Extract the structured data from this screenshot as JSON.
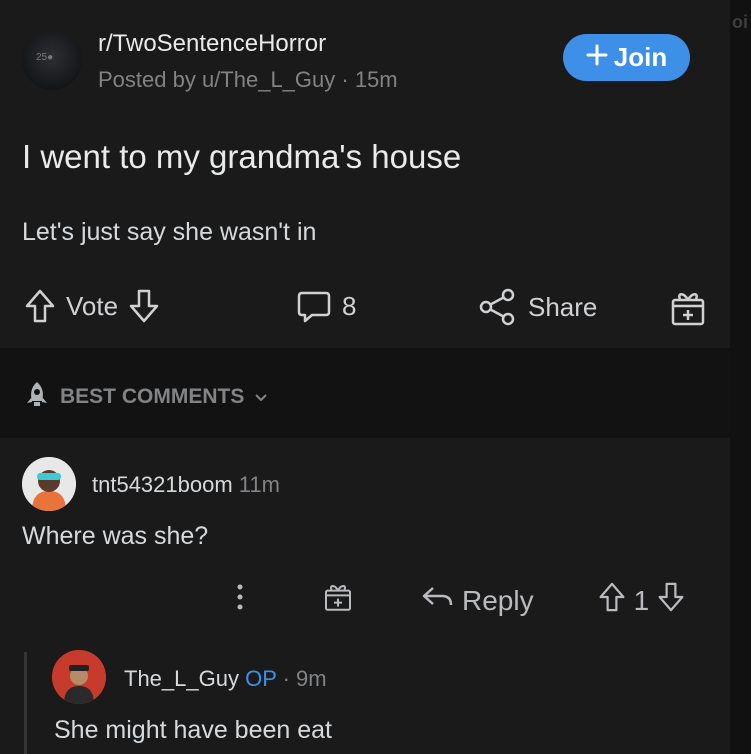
{
  "post": {
    "subreddit": "r/TwoSentenceHorror",
    "avatar_text": "25●",
    "posted_by": "Posted by u/The_L_Guy · 15m",
    "join_label": "Join",
    "title": "I went to my grandma's house",
    "body": "Let's just say she wasn't in",
    "vote_label": "Vote",
    "comment_count": "8",
    "share_label": "Share"
  },
  "sort": {
    "label": "BEST COMMENTS"
  },
  "edge_hint": "oi",
  "comments": [
    {
      "user": "tnt54321boom",
      "time": "11m",
      "text": "Where was she?",
      "reply_label": "Reply",
      "votes": "1"
    },
    {
      "user": "The_L_Guy",
      "op_badge": "OP",
      "time": "· 9m",
      "text": "She might have been eat"
    }
  ],
  "colors": {
    "accent": "#3d8fe7",
    "bg": "#1a1a1b",
    "text": "#d7dadc",
    "muted": "#818384"
  }
}
